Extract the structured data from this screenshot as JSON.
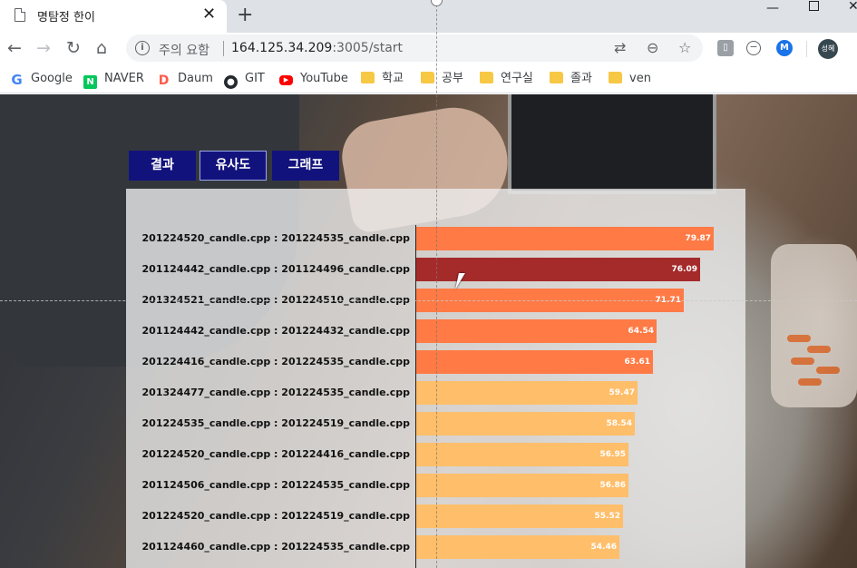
{
  "browser": {
    "tab_title": "명탐정 한이",
    "tab_close": "✕",
    "new_tab": "+",
    "security_label": "주의 요함",
    "url_host": "164.125.34.209",
    "url_path": ":3005/start",
    "profile_initials": "성혜",
    "ext_m_label": "M"
  },
  "bookmarks": [
    {
      "label": "Google",
      "icon": "google-icon"
    },
    {
      "label": "NAVER",
      "icon": "naver-icon"
    },
    {
      "label": "Daum",
      "icon": "daum-icon"
    },
    {
      "label": "GIT",
      "icon": "github-icon"
    },
    {
      "label": "YouTube",
      "icon": "youtube-icon"
    },
    {
      "label": "학교",
      "icon": "folder-icon"
    },
    {
      "label": "공부",
      "icon": "folder-icon"
    },
    {
      "label": "연구실",
      "icon": "folder-icon"
    },
    {
      "label": "졸과",
      "icon": "folder-icon"
    },
    {
      "label": "ven",
      "icon": "folder-icon"
    }
  ],
  "nav": {
    "result": "결과",
    "similarity": "유사도",
    "graph": "그래프",
    "active": "similarity"
  },
  "colors": {
    "high": "#ff7a45",
    "highlight": "#a52a2a",
    "mid": "#ffbe6a",
    "nav_bg": "#12127d"
  },
  "chart_data": {
    "type": "bar",
    "orientation": "horizontal",
    "xlim": [
      0,
      100
    ],
    "categories": [
      "201224520_candle.cpp : 201224535_candle.cpp",
      "201124442_candle.cpp : 201124496_candle.cpp",
      "201324521_candle.cpp : 201224510_candle.cpp",
      "201124442_candle.cpp : 201224432_candle.cpp",
      "201224416_candle.cpp : 201224535_candle.cpp",
      "201324477_candle.cpp : 201224535_candle.cpp",
      "201224535_candle.cpp : 201224519_candle.cpp",
      "201224520_candle.cpp : 201224416_candle.cpp",
      "201124506_candle.cpp : 201224535_candle.cpp",
      "201224520_candle.cpp : 201224519_candle.cpp",
      "201124460_candle.cpp : 201224535_candle.cpp"
    ],
    "values": [
      79.87,
      76.09,
      71.71,
      64.54,
      63.61,
      59.47,
      58.54,
      56.95,
      56.86,
      55.52,
      54.46
    ],
    "highlighted_index": 1
  }
}
